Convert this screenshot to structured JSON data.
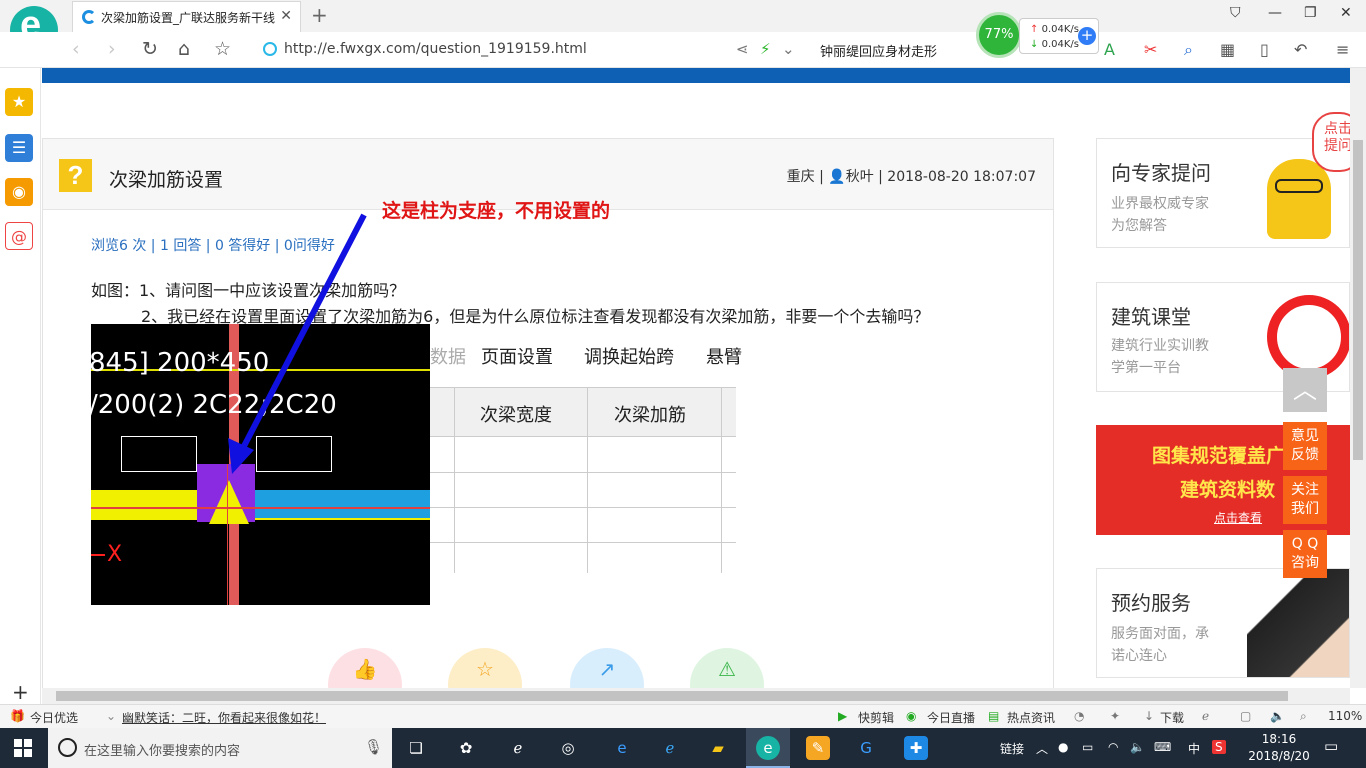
{
  "browser": {
    "tab_title": "次梁加筋设置_广联达服务新干线",
    "url": "http://e.fwxgx.com/question_1919159.html",
    "search_hint": "钟丽缇回应身材走形",
    "speed_percent": "77%",
    "upload_speed": "0.04K/s",
    "download_speed": "0.04K/s"
  },
  "question": {
    "title": "次梁加筋设置",
    "meta": "重庆 | 👤秋叶 | 2018-08-20 18:07:07",
    "stats": "浏览6 次 | 1 回答 | 0 答得好 | 0问得好",
    "line1": "如图：1、请问图一中应该设置次梁加筋吗？",
    "line2": "2、我已经在设置里面设置了次梁加筋为6，但是为什么原位标注查看发现都没有次梁加筋，非要一个个去输吗？"
  },
  "annotation": "这是柱为支座，不用设置的",
  "cad": {
    "line1": "845] 200*450",
    "line2": "/200(2) 2C22;2C20",
    "x_label": "X"
  },
  "table_screenshot": {
    "menu": [
      "数据",
      "页面设置",
      "调换起始跨",
      "悬臂"
    ],
    "columns": [
      "次梁宽度",
      "次梁加筋"
    ]
  },
  "right": {
    "expert_title": "向专家提问",
    "expert_sub1": "业界最权威专家",
    "expert_sub2": "为您解答",
    "classroom_title": "建筑课堂",
    "classroom_sub1": "建筑行业实训教",
    "classroom_sub2": "学第一平台",
    "banner_line1": "图集规范覆盖广",
    "banner_line2": "建筑资料数",
    "banner_link": "点击查看",
    "service_title": "预约服务",
    "service_sub1": "服务面对面，承",
    "service_sub2": "诺心连心",
    "ask_bubble1": "点击",
    "ask_bubble2": "提问"
  },
  "float": {
    "feedback1": "意见",
    "feedback2": "反馈",
    "follow1": "关注",
    "follow2": "我们",
    "qq1": "Q Q",
    "qq2": "咨询"
  },
  "statusbar": {
    "today_pick": "今日优选",
    "news": "幽默笑话：二旺，你看起来很像如花！",
    "kuaijianji": "快剪辑",
    "live": "今日直播",
    "hot": "热点资讯",
    "download": "下载",
    "zoom": "110%"
  },
  "taskbar": {
    "search_placeholder": "在这里输入你要搜索的内容",
    "tray_link": "链接",
    "ime": "中",
    "time": "18:16",
    "date": "2018/8/20"
  }
}
